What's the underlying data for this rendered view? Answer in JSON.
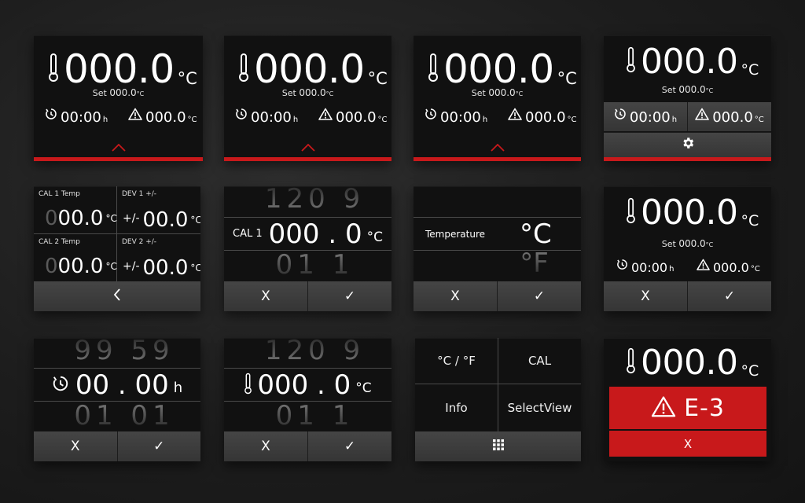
{
  "colors": {
    "accent_red": "#c8191b",
    "panel_bg": "#111111",
    "button_bg": "#404040"
  },
  "icons": [
    "thermometer-icon",
    "timer-icon",
    "warning-icon",
    "chevron-up-icon",
    "gear-icon",
    "chevron-left-icon",
    "close-icon",
    "check-icon",
    "grid-icon"
  ],
  "home": {
    "temp": "000.0",
    "unit": "°C",
    "set_label": "Set",
    "set_value": "000.0",
    "set_unit": "°C",
    "timer_value": "00:00",
    "timer_unit": "h",
    "alarm_value": "000.0",
    "alarm_unit": "°C"
  },
  "cal_overview": {
    "cal1_label": "CAL 1 Temp",
    "dev1_label": "DEV 1 +/-",
    "cal2_label": "CAL 2 Temp",
    "dev2_label": "DEV 2 +/-",
    "cal_digit_dim": "0",
    "cal_value_rest": "00.0",
    "pm": "+/-",
    "dev_value": "00.0",
    "unit": "°C",
    "back_label": "<"
  },
  "cal_picker": {
    "label": "CAL 1",
    "above": "120  9",
    "value": "000 . 0",
    "unit": "°C",
    "below": "01  1"
  },
  "unit_picker": {
    "label": "Temperature",
    "selected": "°C",
    "below": "°F"
  },
  "timer_picker": {
    "above": "99  59",
    "value": "00 . 00",
    "unit": "h",
    "below": "01  01"
  },
  "temp_picker": {
    "above": "120  9",
    "value": "000 . 0",
    "unit": "°C",
    "below": "01  1"
  },
  "menu": {
    "unit_toggle": "°C / °F",
    "cal": "CAL",
    "info": "Info",
    "select_view": "SelectView"
  },
  "buttons": {
    "cancel": "X",
    "confirm": "✓"
  },
  "error": {
    "code": "E-3",
    "dismiss": "X"
  }
}
